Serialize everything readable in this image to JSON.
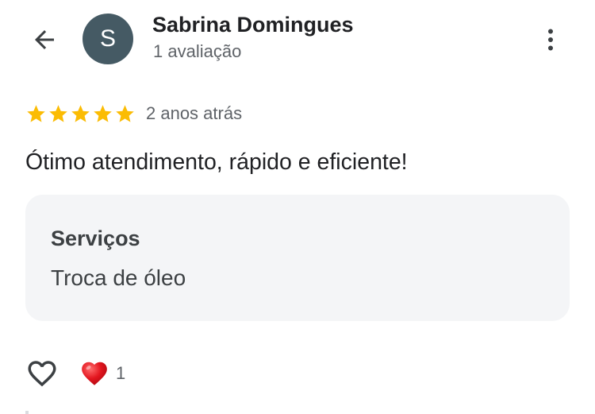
{
  "header": {
    "back_icon": "arrow-left-icon",
    "avatar_letter": "S",
    "avatar_color": "#455a64",
    "reviewer_name": "Sabrina Domingues",
    "reviewer_meta": "1 avaliação",
    "more_icon": "more-vert-icon"
  },
  "review": {
    "rating": 5,
    "rating_max": 5,
    "star_color": "#fbbc04",
    "time_ago": "2 anos atrás",
    "text": "Ótimo atendimento, rápido e eficiente!"
  },
  "services": {
    "title": "Serviços",
    "value": "Troca de óleo"
  },
  "actions": {
    "like_icon": "heart-outline-icon",
    "reaction_icon": "red-heart-icon",
    "reaction_count": "1"
  }
}
